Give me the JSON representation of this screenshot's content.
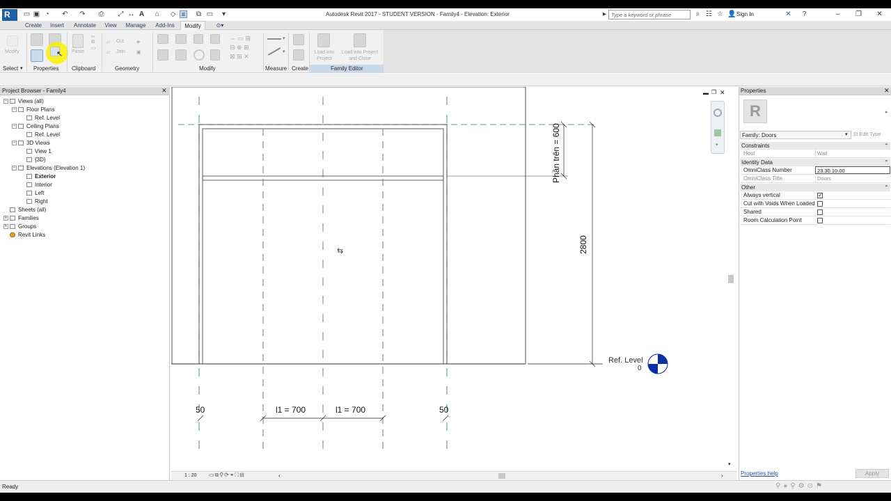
{
  "titlebar": {
    "title": "Autodesk Revit 2017 - STUDENT VERSION -    Family4 - Elevation: Exterior",
    "search_placeholder": "Type a keyword or phrase",
    "sign_in": "Sign In"
  },
  "tabs": [
    "Create",
    "Insert",
    "Annotate",
    "View",
    "Manage",
    "Add-Ins",
    "Modify"
  ],
  "active_tab": "Modify",
  "ribbon": {
    "modify_label": "Modify",
    "paste_label": "Paste",
    "cut_label": "Cut",
    "join_label": "Join",
    "load_into_project": "Load into Project",
    "load_into_project_close": "Load into Project and Close",
    "panels": {
      "select": "Select",
      "properties": "Properties",
      "clipboard": "Clipboard",
      "geometry": "Geometry",
      "modify": "Modify",
      "measure": "Measure",
      "create": "Create",
      "family_editor": "Family Editor"
    }
  },
  "project_browser": {
    "title": "Project Browser - Family4",
    "items": [
      {
        "label": "Views (all)",
        "level": 0,
        "toggle": "−"
      },
      {
        "label": "Floor Plans",
        "level": 1,
        "toggle": "−"
      },
      {
        "label": "Ref. Level",
        "level": 2,
        "toggle": ""
      },
      {
        "label": "Ceiling Plans",
        "level": 1,
        "toggle": "−"
      },
      {
        "label": "Ref. Level",
        "level": 2,
        "toggle": ""
      },
      {
        "label": "3D Views",
        "level": 1,
        "toggle": "−"
      },
      {
        "label": "View 1",
        "level": 2,
        "toggle": ""
      },
      {
        "label": "{3D}",
        "level": 2,
        "toggle": ""
      },
      {
        "label": "Elevations (Elevation 1)",
        "level": 1,
        "toggle": "−"
      },
      {
        "label": "Exterior",
        "level": 2,
        "toggle": "",
        "bold": true
      },
      {
        "label": "Interior",
        "level": 2,
        "toggle": ""
      },
      {
        "label": "Left",
        "level": 2,
        "toggle": ""
      },
      {
        "label": "Right",
        "level": 2,
        "toggle": ""
      },
      {
        "label": "Sheets (all)",
        "level": 0,
        "toggle": ""
      },
      {
        "label": "Families",
        "level": 0,
        "toggle": "+"
      },
      {
        "label": "Groups",
        "level": 0,
        "toggle": "+"
      },
      {
        "label": "Revit Links",
        "level": 0,
        "toggle": ""
      }
    ]
  },
  "drawing": {
    "dim_top": "Phần trên = 600",
    "dim_height": "2800",
    "ref_level_name": "Ref. Level",
    "ref_level_value": "0",
    "dim_left": "50",
    "dim_mid1": "l1 = 700",
    "dim_mid2": "l1 = 700",
    "dim_right": "50"
  },
  "viewbar": {
    "scale": "1 : 20"
  },
  "properties": {
    "title": "Properties",
    "type_selector": "Family: Doors",
    "edit_type": "Edit Type",
    "sections": {
      "constraints": "Constraints",
      "identity": "Identity Data",
      "other": "Other"
    },
    "rows": {
      "host_label": "Host",
      "host_value": "Wall",
      "omni_number_label": "OmniClass Number",
      "omni_number_value": "23.30.10.00",
      "omni_title_label": "OmniClass Title",
      "omni_title_value": "Doors",
      "always_vertical": "Always vertical",
      "cut_with_voids": "Cut with Voids When Loaded",
      "shared": "Shared",
      "room_calc": "Room Calculation Point"
    },
    "help_link": "Properties help",
    "apply": "Apply"
  },
  "status": {
    "text": "Ready"
  },
  "colors": {
    "ref_plane_green": "#2e7d32",
    "level_marker_blue": "#0b2fa5"
  }
}
